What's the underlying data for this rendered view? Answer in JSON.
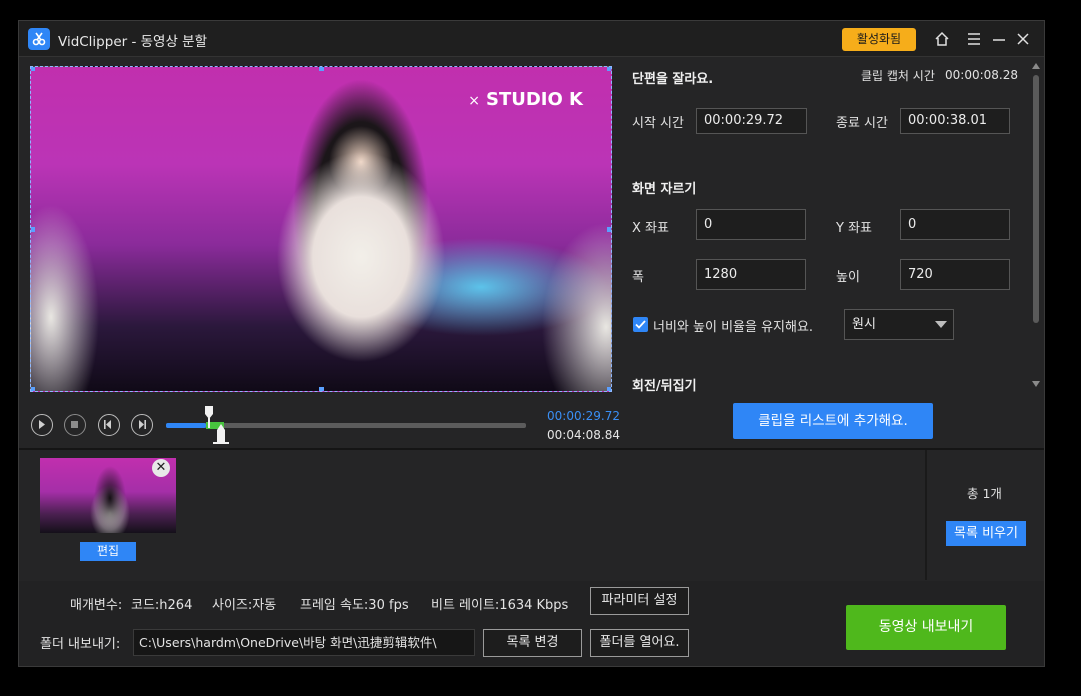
{
  "titlebar": {
    "app_title": "VidClipper - 동영상 분할",
    "activate_label": "활성화됨",
    "icons": [
      "home-icon",
      "menu-icon",
      "minimize-icon",
      "close-icon"
    ]
  },
  "player": {
    "overlay_logo": "STUDIO K",
    "overlay_x": "×",
    "current_time": "00:00:29.72",
    "total_time": "00:04:08.84",
    "progress_fraction": 0.12,
    "controls": [
      "play-icon",
      "stop-icon",
      "prev-frame-icon",
      "next-frame-icon"
    ]
  },
  "clip_panel": {
    "heading": "단편을 잘라요.",
    "capture_label": "클립 캡처 시간",
    "capture_value": "00:00:08.28",
    "start_label": "시작 시간",
    "start_value": "00:00:29.72",
    "end_label": "종료 시간",
    "end_value": "00:00:38.01",
    "crop_heading": "화면 자르기",
    "x_label": "X 좌표",
    "x_value": "0",
    "y_label": "Y 좌표",
    "y_value": "0",
    "width_label": "폭",
    "width_value": "1280",
    "height_label": "높이",
    "height_value": "720",
    "keep_ratio_label": "너비와 높이 비율을 유지해요.",
    "keep_ratio_checked": true,
    "ratio_selected": "원시",
    "rotate_heading": "회전/뒤집기",
    "add_button": "클립을 리스트에 추가해요."
  },
  "clip_list": {
    "edit_label": "편집",
    "close_glyph": "✕",
    "total_label": "총 1개",
    "clear_label": "목록 비우기"
  },
  "output": {
    "params_label": "매개변수:",
    "codec": "코드:h264",
    "size": "사이즈:자동",
    "framerate": "프레임 속도:30 fps",
    "bitrate": "비트 레이트:1634 Kbps",
    "param_settings_button": "파라미터 설정",
    "folder_label": "폴더 내보내기:",
    "folder_path": "C:\\Users\\hardm\\OneDrive\\바탕 화면\\迅捷剪辑软件\\",
    "change_dir_button": "목록 변경",
    "open_folder_button": "폴더를 열어요.",
    "export_button": "동영상 내보내기"
  },
  "colors": {
    "accent_blue": "#2f86f6",
    "export_green": "#4fb81c",
    "activate_yellow": "#f6ad1a",
    "background": "#252526"
  }
}
